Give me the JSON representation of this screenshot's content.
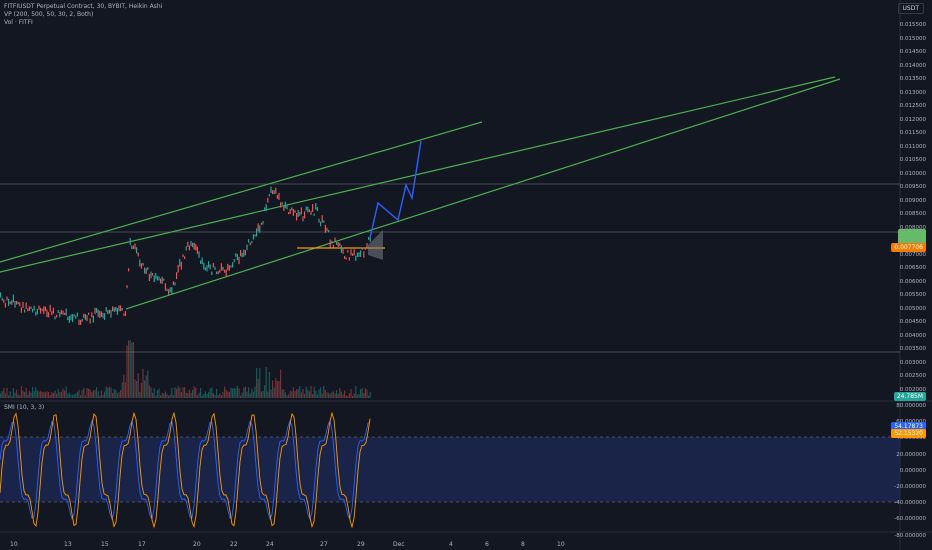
{
  "chart": {
    "symbol_line": "FITFIUSDT Perpetual Contract, 30, BYBIT, Heikin Ashi",
    "vp_line": "VP (200, 500, 50, 30, 2, Both)",
    "vol_line": "Vol · FITFI",
    "smi_line": "SMI (10, 3, 3)",
    "currency": "USDT"
  },
  "price_axis": {
    "ticks": [
      "0.015500",
      "0.015000",
      "0.014500",
      "0.014000",
      "0.013500",
      "0.013000",
      "0.012500",
      "0.012000",
      "0.011500",
      "0.011000",
      "0.010500",
      "0.010000",
      "0.009500",
      "0.009000",
      "0.008500",
      "0.008000",
      "0.007500",
      "0.007000",
      "0.006500",
      "0.006000",
      "0.005500",
      "0.005000",
      "0.004500",
      "0.004000",
      "0.003500",
      "0.003000",
      "0.002500",
      "0.002000"
    ],
    "current_price": "0.007706",
    "badge_green": "",
    "volume_badge": "24.785M"
  },
  "smi_axis": {
    "ticks": [
      "80.000000",
      "60.000000",
      "40.000000",
      "20.000000",
      "0.000000",
      "-20.000000",
      "-40.000000",
      "-60.000000",
      "-80.000000"
    ],
    "badge_blue": "54.17873",
    "badge_orange": "52.15320"
  },
  "time_axis": {
    "ticks": [
      "10",
      "13",
      "15",
      "17",
      "20",
      "22",
      "24",
      "27",
      "29",
      "Dec",
      "4",
      "6",
      "8",
      "10"
    ]
  },
  "colors": {
    "background": "#131722",
    "channel_green": "#4caf50",
    "projection_blue": "#2962ff",
    "smi_orange": "#ff9800",
    "smi_band": "#1e2a56",
    "support_orange": "#ff9800"
  }
}
